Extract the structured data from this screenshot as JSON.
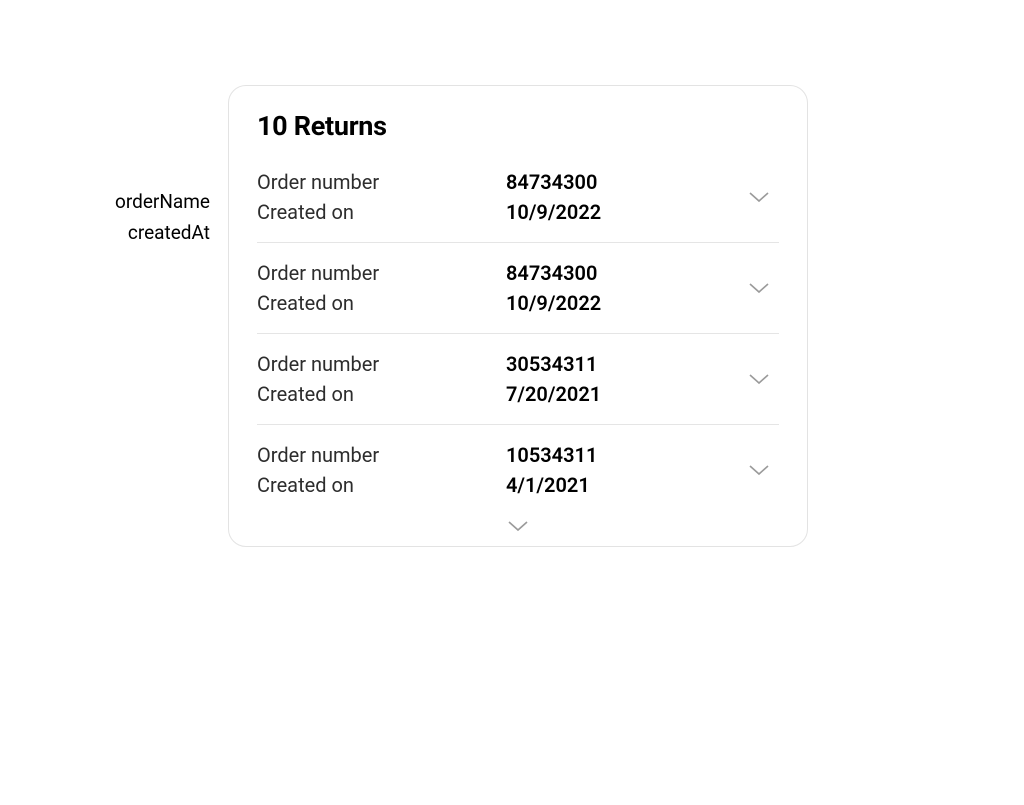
{
  "slot_labels": {
    "order_name": "orderName",
    "created_at": "createdAt"
  },
  "card": {
    "title": "10 Returns",
    "labels": {
      "order_number": "Order number",
      "created_on": "Created on"
    },
    "items": [
      {
        "order_number": "84734300",
        "created_on": "10/9/2022"
      },
      {
        "order_number": "84734300",
        "created_on": "10/9/2022"
      },
      {
        "order_number": "30534311",
        "created_on": "7/20/2021"
      },
      {
        "order_number": "10534311",
        "created_on": "4/1/2021"
      }
    ]
  }
}
